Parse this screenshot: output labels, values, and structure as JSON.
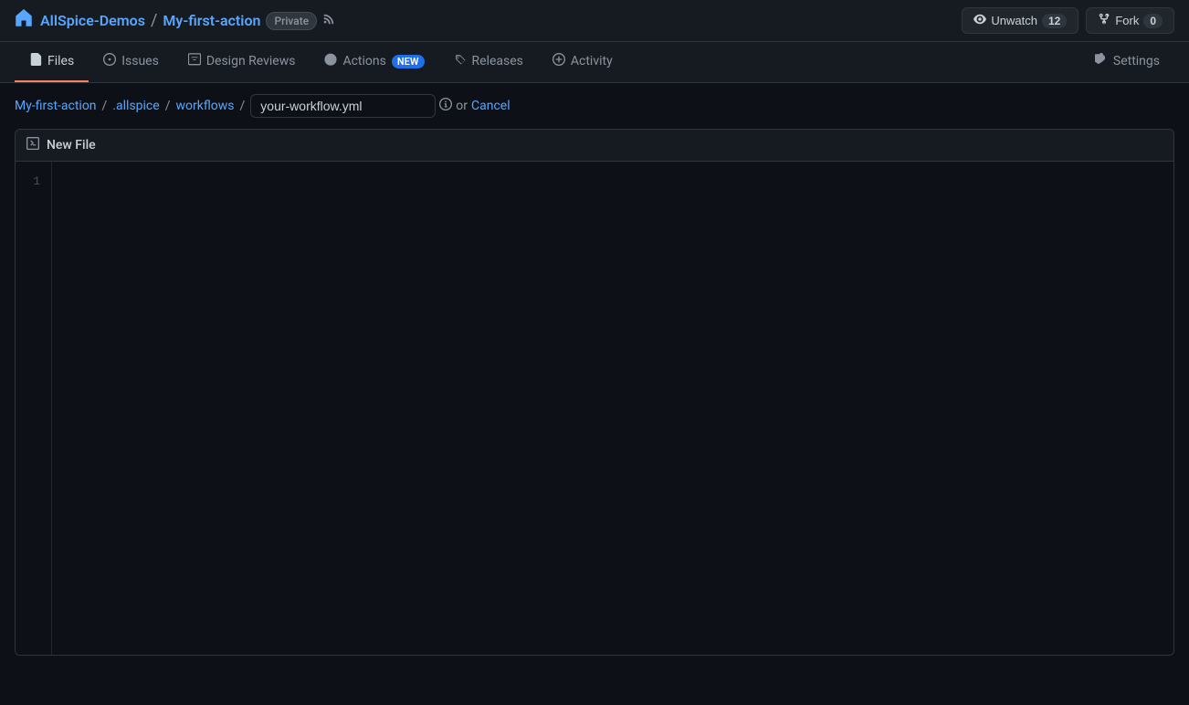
{
  "app": {
    "logo_label": "AllSpice",
    "home_icon": "home-icon"
  },
  "repo": {
    "owner": "AllSpice-Demos",
    "owner_href": "#",
    "separator": "/",
    "name": "My-first-action",
    "name_href": "#",
    "visibility": "Private",
    "rss_title": "RSS Feed"
  },
  "header_actions": {
    "unwatch_label": "Unwatch",
    "unwatch_count": "12",
    "fork_label": "Fork",
    "fork_count": "0"
  },
  "nav": {
    "items": [
      {
        "id": "files",
        "label": "Files",
        "active": true,
        "badge": null
      },
      {
        "id": "issues",
        "label": "Issues",
        "active": false,
        "badge": null
      },
      {
        "id": "design-reviews",
        "label": "Design Reviews",
        "active": false,
        "badge": null
      },
      {
        "id": "actions",
        "label": "Actions",
        "active": false,
        "badge": "new"
      },
      {
        "id": "releases",
        "label": "Releases",
        "active": false,
        "badge": null
      },
      {
        "id": "activity",
        "label": "Activity",
        "active": false,
        "badge": null
      },
      {
        "id": "settings",
        "label": "Settings",
        "active": false,
        "badge": null
      }
    ]
  },
  "breadcrumb": {
    "root": "My-first-action",
    "root_href": "#",
    "seg1": ".allspice",
    "seg1_href": "#",
    "seg2": "workflows",
    "seg2_href": "#",
    "filename_placeholder": "your-workflow.yml",
    "filename_value": "your-workflow.yml",
    "or_text": "or",
    "cancel_text": "Cancel"
  },
  "editor": {
    "title": "New File",
    "line_numbers": [
      "1"
    ],
    "content": ""
  }
}
